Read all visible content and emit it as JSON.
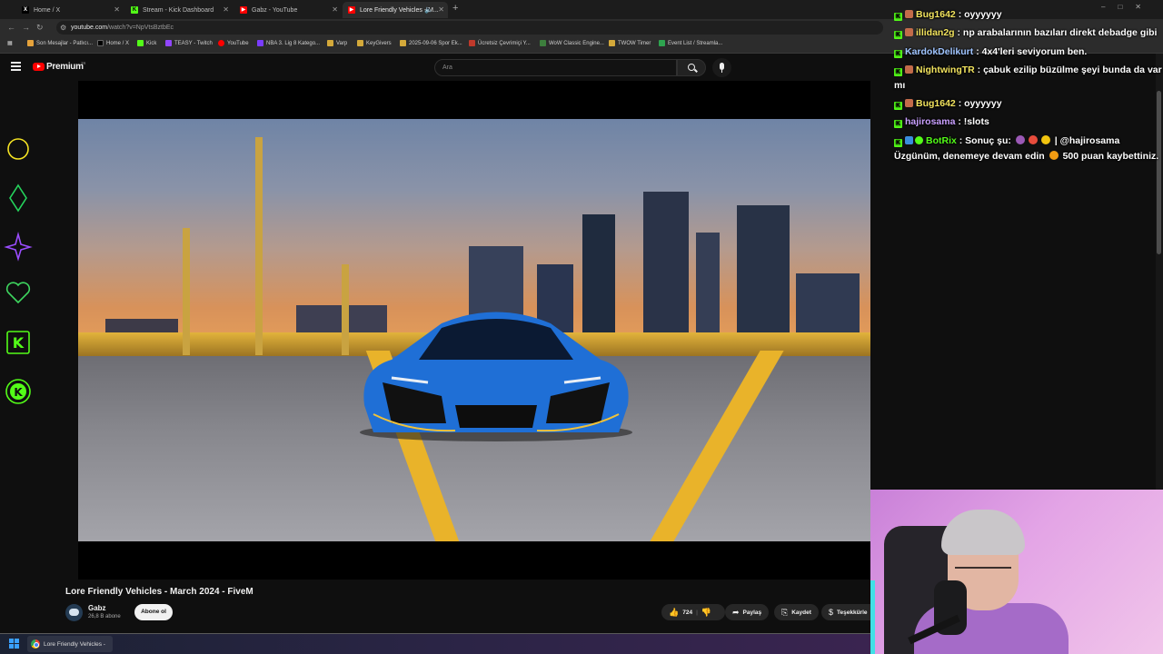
{
  "browser": {
    "tabs": [
      {
        "label": "Home / X",
        "icon": "x-logo-icon",
        "color": "#000000"
      },
      {
        "label": "Stream - Kick Dashboard",
        "icon": "kick-logo-icon",
        "color": "#53fc18"
      },
      {
        "label": "Gabz - YouTube",
        "icon": "youtube-logo-icon",
        "color": "#ff0000"
      },
      {
        "label": "Lore Friendly Vehicles - M...",
        "icon": "youtube-logo-icon",
        "color": "#ff0000"
      }
    ],
    "url_host": "youtube.com",
    "url_path": "/watch?v=NpVtsBztbEc",
    "bookmarks": [
      {
        "label": "Son Mesajlar - Patlıcı...",
        "color": "#e5a23b"
      },
      {
        "label": "Home / X",
        "color": "#000000"
      },
      {
        "label": "Kick",
        "color": "#53fc18"
      },
      {
        "label": "TEASY - Twitch",
        "color": "#9146ff"
      },
      {
        "label": "YouTube",
        "color": "#ff0000"
      },
      {
        "label": "NBA 3. Lig 8 Katego...",
        "color": "#7a3cff"
      },
      {
        "label": "Varp",
        "color": "#d4a93a"
      },
      {
        "label": "KeyGivers",
        "color": "#d4a93a"
      },
      {
        "label": "2025-09-06 Spor Ek...",
        "color": "#d4a93a"
      },
      {
        "label": "Ücretsiz Çevrimiçi Y...",
        "color": "#c0392b"
      },
      {
        "label": "WoW Classic Engine...",
        "color": "#3d7f3d"
      },
      {
        "label": "TWOW Timer",
        "color": "#d4a93a"
      },
      {
        "label": "Event List / Streamla...",
        "color": "#2ea44f"
      }
    ]
  },
  "youtube": {
    "brand": "Premium",
    "country": "TR",
    "search_placeholder": "Ara"
  },
  "video": {
    "title": "Lore Friendly Vehicles - March 2024 - FiveM",
    "channel": "Gabz",
    "subscribers": "26,8 B abone",
    "subscribe_label": "Abone ol",
    "likes": "724",
    "share_label": "Paylaş",
    "save_label": "Kaydet",
    "thanks_label": "Teşekkürle"
  },
  "chat": {
    "messages": [
      {
        "user": "Bug1642",
        "text": ": oyyyyyy",
        "user_color": "#f2e35e"
      },
      {
        "user": "illidan2g",
        "text": ": np arabalarının bazıları direkt debadge gibi",
        "user_color": "#f2e35e"
      },
      {
        "user": "KardokDelikurt",
        "text": ": 4x4'leri seviyorum ben.",
        "user_color": "#9fc4ff"
      },
      {
        "user": "NightwingTR",
        "text": ": çabuk ezilip büzülme şeyi bunda da var",
        "user_color": "#f2e35e"
      },
      {
        "user": "",
        "text": "mı",
        "user_color": "#ffffff"
      },
      {
        "user": "Bug1642",
        "text": ": oyyyyyy",
        "user_color": "#f2e35e"
      },
      {
        "user": "hajirosama",
        "text": ": !slots",
        "user_color": "#c9a0ff"
      },
      {
        "user": "BotRix",
        "text": ": Sonuç şu:",
        "user_color": "#53fc18",
        "tail": "| @hajirosama"
      },
      {
        "user": "",
        "text": "Üzgünüm, denemeye devam edin",
        "user_color": "#ffffff",
        "tail": "500 puan kaybettiniz."
      }
    ]
  },
  "taskbar": {
    "task_label": "Lore Friendly Vehicles -"
  }
}
